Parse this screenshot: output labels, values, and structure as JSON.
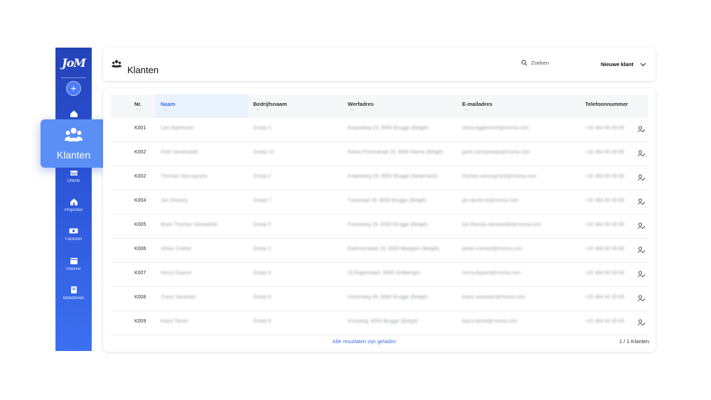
{
  "sidebar": {
    "logo": "JoM",
    "add_label": "+",
    "items": [
      {
        "key": "home",
        "label": ""
      },
      {
        "key": "klanten",
        "label": "Klanten"
      },
      {
        "key": "offers",
        "label": "Offerte"
      },
      {
        "key": "projects",
        "label": "Projecten"
      },
      {
        "key": "invoices",
        "label": "Facturen"
      },
      {
        "key": "planner",
        "label": "Planner"
      },
      {
        "key": "library",
        "label": "Bibliotheek"
      }
    ],
    "active": "klanten"
  },
  "header": {
    "title": "Klanten",
    "search_placeholder": "Zoeken",
    "new_client_label": "Nieuwe klant"
  },
  "table": {
    "columns": [
      "Nr.",
      "Naam",
      "Bedrijfsnaam",
      "Werfadres",
      "E-mailadres",
      "Telefoonnummer"
    ],
    "sort_indicator": "↑↓",
    "active_column": "Naam",
    "rows": [
      {
        "nr": "K001",
        "naam": "Lies Baertsoen",
        "bedrijf": "Groep 3",
        "adres": "Kraaisteeg 29, 8000 Brugge (België)",
        "email": "stony.eggermont@moma.com",
        "tel": "+32 484 60 39 69"
      },
      {
        "nr": "K002",
        "naam": "Griet Vandewalle",
        "bedrijf": "Groep 10",
        "adres": "Kleine Pomestraat 16, 8000 Marne (België)",
        "email": "griek.vanzaswala@moma.com",
        "tel": "+32 484 60 39 69"
      },
      {
        "nr": "K002",
        "naam": "Thomas Vancraynest",
        "bedrijf": "Groep 2",
        "adres": "Kraaisteeg 29, 8000 Brugge (Nederland)",
        "email": "thomas.vancraynest@moma.com",
        "tel": "+32 484 60 39 69"
      },
      {
        "nr": "K004",
        "naam": "Jan Declerq",
        "bedrijf": "Groep 7",
        "adres": "Tuinstraat 39, 8000 Brugge (België)",
        "email": "jan.declerck@moma.com",
        "tel": "+32 484 60 39 69"
      },
      {
        "nr": "K005",
        "naam": "Bram Thomas Vanwaelde",
        "bedrijf": "Groep 5",
        "adres": "Forestweg 28, 8000 Brugge (België)",
        "email": "bst.thomas.vanwaelde@moma.com",
        "tel": "+32 484 60 39 69"
      },
      {
        "nr": "K006",
        "naam": "Johan Coletet",
        "bedrijf": "Groep 3",
        "adres": "Eekhoornpark 16, 8000 Blaagem (België)",
        "email": "johan.coessel@moma.com",
        "tel": "+32 484 60 39 69"
      },
      {
        "nr": "K007",
        "naam": "Henry Dupont",
        "bedrijf": "Groep 4",
        "adres": "St.Rogierslaan, 8000 Outtbergen",
        "email": "henry.dupont@moma.com",
        "tel": "+32 484 60 39 69"
      },
      {
        "nr": "K008",
        "naam": "Travis Vanacker",
        "bedrijf": "Groep 6",
        "adres": "Keizerweg 39, 8000 Brugge (België)",
        "email": "travis.vanacker@moma.com",
        "tel": "+32 484 60 39 69"
      },
      {
        "nr": "K009",
        "naam": "Kaico Tamot",
        "bedrijf": "Groep 8",
        "adres": "Kruisweg, 8000 Brugge (België)",
        "email": "kaico.tamot@moma.com",
        "tel": "+32 484 60 39 69"
      }
    ],
    "footer_status": "Alle resultaten zijn geladen",
    "footer_count": "1 / 1 Klanten"
  },
  "colors": {
    "sidebar_top": "#2443b8",
    "sidebar_bottom": "#3c70f2",
    "active_card": "#5b8ff5",
    "accent": "#3b70ea"
  }
}
